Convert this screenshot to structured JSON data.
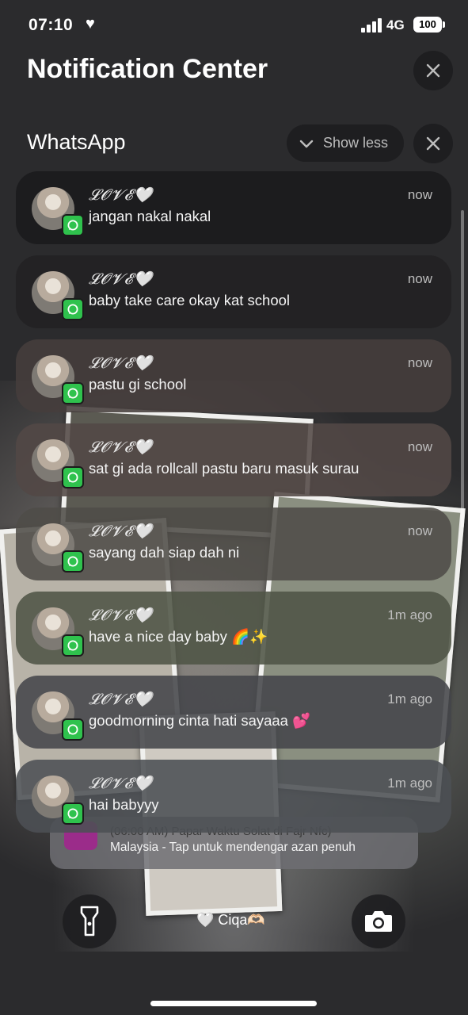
{
  "status_bar": {
    "time": "07:10",
    "time_icon": "heart-icon",
    "network": "4G",
    "battery": "100"
  },
  "header": {
    "title": "Notification Center",
    "close_icon": "close-icon"
  },
  "group": {
    "app_name": "WhatsApp",
    "show_less_label": "Show less",
    "clear_icon": "close-icon"
  },
  "notifications": [
    {
      "sender": "𝓛𝓞𝓥𝓔🤍",
      "message": "jangan nakal nakal",
      "time": "now"
    },
    {
      "sender": "𝓛𝓞𝓥𝓔🤍",
      "message": "baby take care okay kat school",
      "time": "now"
    },
    {
      "sender": "𝓛𝓞𝓥𝓔🤍",
      "message": "pastu gi school",
      "time": "now"
    },
    {
      "sender": "𝓛𝓞𝓥𝓔🤍",
      "message": "sat gi ada rollcall pastu baru masuk surau",
      "time": "now"
    },
    {
      "sender": "𝓛𝓞𝓥𝓔🤍",
      "message": "sayang dah siap dah ni",
      "time": "now"
    },
    {
      "sender": "𝓛𝓞𝓥𝓔🤍",
      "message": "have a nice day baby 🌈✨",
      "time": "1m ago"
    },
    {
      "sender": "𝓛𝓞𝓥𝓔🤍",
      "message": "goodmorning cinta hati sayaaa 💕",
      "time": "1m ago"
    },
    {
      "sender": "𝓛𝓞𝓥𝓔🤍",
      "message": "hai babyyy",
      "time": "1m ago"
    }
  ],
  "stacked_notification": {
    "line1": "(06:00 AM) Papar Waktu Solat di Fajr Nfc)",
    "line2": "Malaysia - Tap untuk mendengar azan penuh"
  },
  "lockscreen": {
    "owner_label": "🤍 Ciqa🫶🏻",
    "flashlight_icon": "flashlight-icon",
    "camera_icon": "camera-icon"
  },
  "colors": {
    "whatsapp_green": "#2fc24d",
    "background": "#2b2b2d"
  }
}
